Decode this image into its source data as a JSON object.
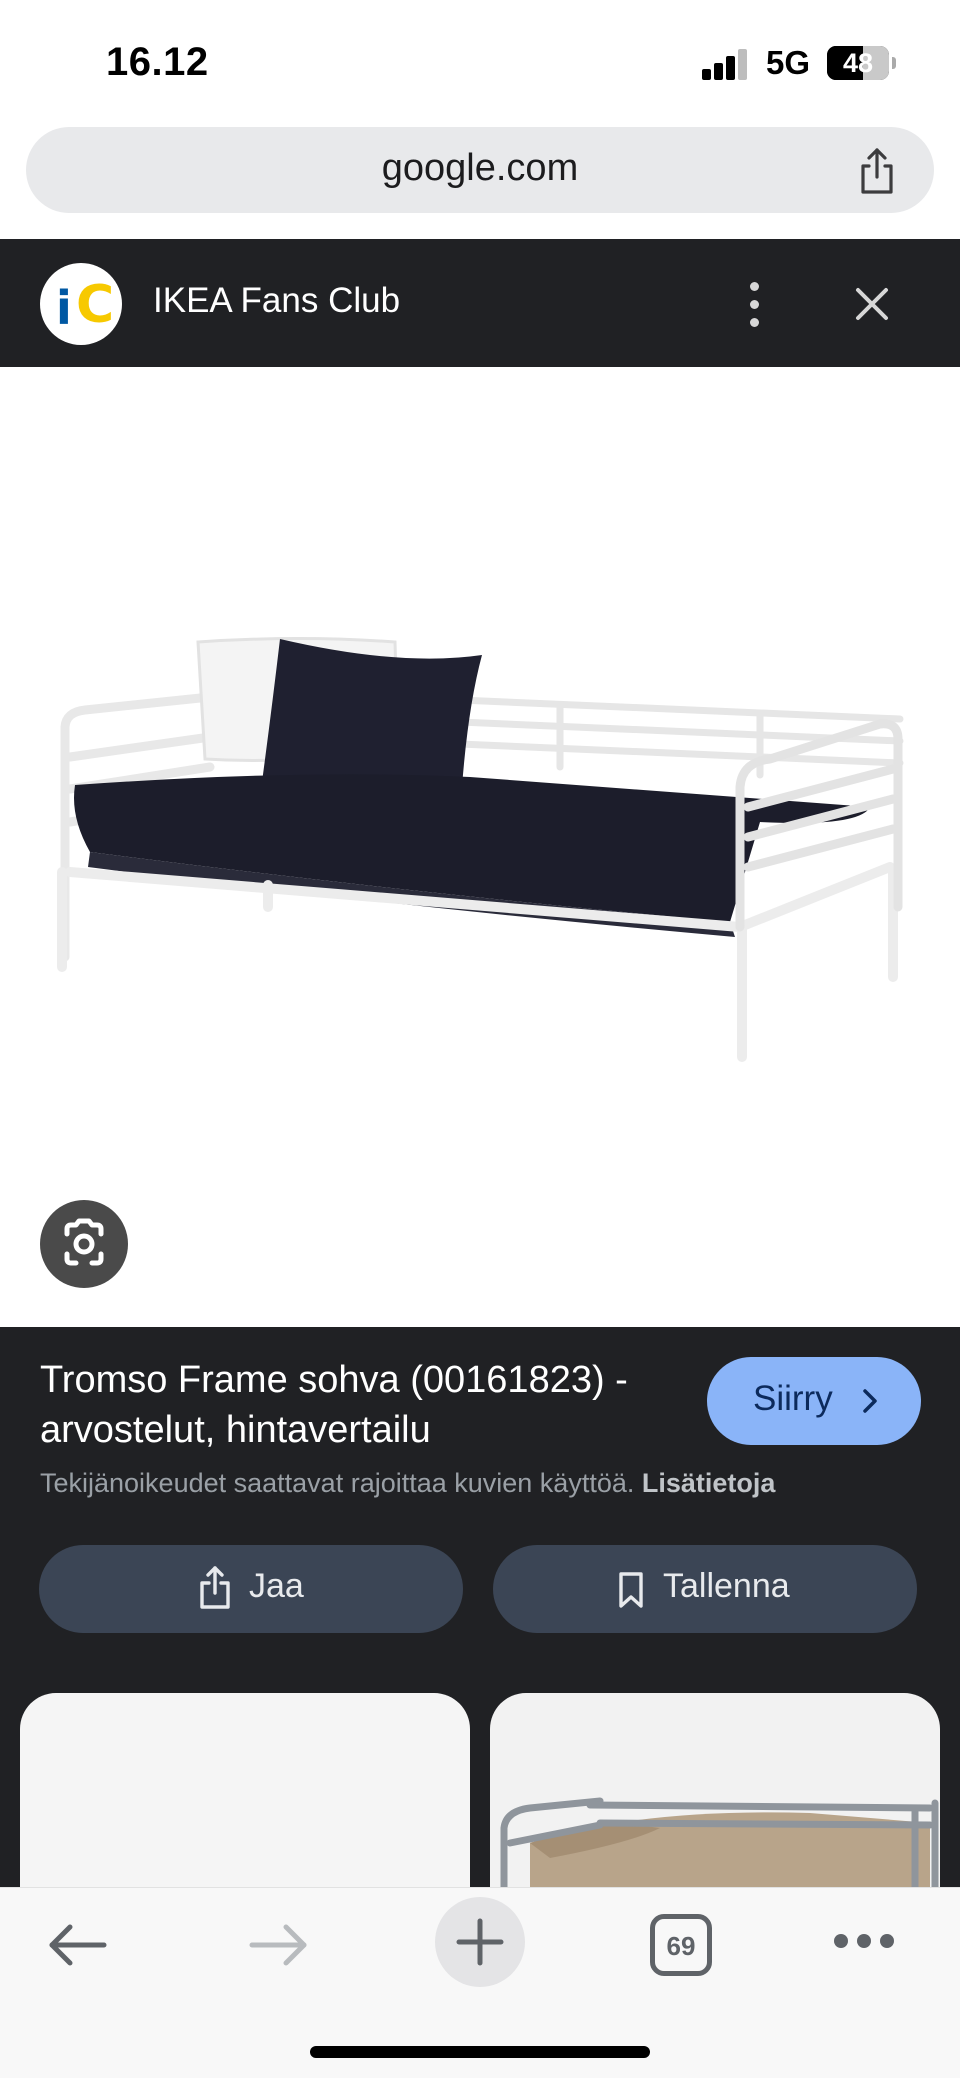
{
  "status": {
    "time": "16.12",
    "network": "5G",
    "battery": "48"
  },
  "browser": {
    "url": "google.com",
    "tab_count": "69"
  },
  "lens": {
    "site_name": "IKEA Fans Club",
    "title": "Tromso Frame sohva (00161823) - arvostelut, hintavertailu",
    "go_label": "Siirry",
    "copyright_text": "Tekijänoikeudet saattavat rajoittaa kuvien käyttöä.",
    "copyright_more": "Lisätietoja",
    "share_label": "Jaa",
    "save_label": "Tallenna"
  },
  "colors": {
    "panel": "#202124",
    "accent": "#8ab4f8",
    "action": "#3b4555"
  }
}
